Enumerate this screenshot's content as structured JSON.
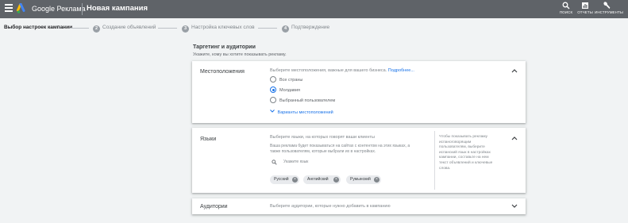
{
  "header": {
    "brand": "Google Реклама",
    "page_title": "Новая кампания",
    "actions": [
      {
        "label": "ПОИСК",
        "icon": "search-icon"
      },
      {
        "label": "ОТЧЕТЫ",
        "icon": "reports-icon"
      },
      {
        "label": "ИНСТРУМЕНТЫ",
        "icon": "wrench-icon"
      }
    ]
  },
  "stepper": {
    "steps": [
      {
        "label": "Выбор настроек кампании",
        "number": "",
        "active": true
      },
      {
        "label": "Создание объявлений",
        "number": "2"
      },
      {
        "label": "Настройка ключевых слов",
        "number": "3"
      },
      {
        "label": "Подтверждение",
        "number": "4"
      }
    ]
  },
  "section": {
    "title": "Таргетинг и аудитории",
    "subtitle": "Укажите, кому вы хотите показывать рекламу."
  },
  "locations": {
    "label": "Местоположения",
    "prompt": "Выберите местоположения, важные для вашего бизнеса.",
    "more_link": "Подробнее...",
    "options": [
      {
        "label": "Все страны",
        "selected": false
      },
      {
        "label": "Молдавия",
        "selected": true
      },
      {
        "label": "Выбранный пользователем",
        "selected": false
      }
    ],
    "variants_link": "Варианты местоположений"
  },
  "languages": {
    "label": "Языки",
    "prompt": "Выберите языки, на которых говорят ваши клиенты",
    "description_line1": "Ваша реклама будет показываться на сайтах с контентом на этих языках, а",
    "description_line2": "также пользователям, которые выбрали их в настройках.",
    "search_placeholder": "Укажите язык",
    "chips": [
      "Русский",
      "Английский",
      "Румынский"
    ],
    "hint": [
      "Чтобы показывать рекламу",
      "испаноговорящим",
      "пользователям, выберите",
      "испанский язык в настройках",
      "кампании, составьте на нем",
      "текст объявлений и ключевые",
      "слова."
    ]
  },
  "audiences": {
    "label": "Аудитории",
    "prompt": "Выберите аудитории, которые нужно добавить в кампанию"
  }
}
